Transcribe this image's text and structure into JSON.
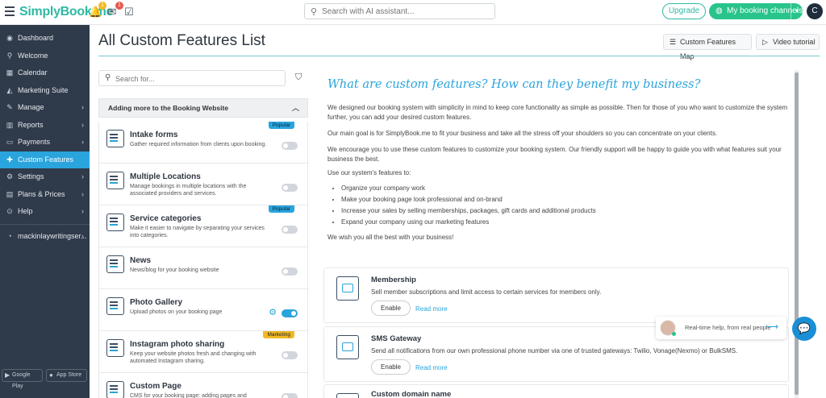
{
  "header": {
    "logo": "SimplyBook.me",
    "notifications_badge": "1",
    "messages_badge": "1",
    "search_placeholder": "Search with AI assistant...",
    "upgrade_label": "Upgrade",
    "channels_label": "My booking channels",
    "avatar_letter": "C"
  },
  "sidebar": {
    "items": [
      {
        "label": "Dashboard",
        "icon": "dashboard-icon",
        "glyph": "◉",
        "chevron": false,
        "active": false
      },
      {
        "label": "Welcome",
        "icon": "pin-icon",
        "glyph": "⚲",
        "chevron": false,
        "active": false
      },
      {
        "label": "Calendar",
        "icon": "calendar-icon",
        "glyph": "▦",
        "chevron": false,
        "active": false
      },
      {
        "label": "Marketing Suite",
        "icon": "megaphone-icon",
        "glyph": "◭",
        "chevron": false,
        "active": false
      },
      {
        "label": "Manage",
        "icon": "pencil-icon",
        "glyph": "✎",
        "chevron": true,
        "active": false
      },
      {
        "label": "Reports",
        "icon": "chart-icon",
        "glyph": "▥",
        "chevron": true,
        "active": false
      },
      {
        "label": "Payments",
        "icon": "card-icon",
        "glyph": "▭",
        "chevron": true,
        "active": false
      },
      {
        "label": "Custom Features",
        "icon": "puzzle-icon",
        "glyph": "✚",
        "chevron": false,
        "active": true
      },
      {
        "label": "Settings",
        "icon": "gear-icon",
        "glyph": "⚙",
        "chevron": true,
        "active": false
      },
      {
        "label": "Plans & Prices",
        "icon": "tag-icon",
        "glyph": "▤",
        "chevron": true,
        "active": false
      },
      {
        "label": "Help",
        "icon": "help-icon",
        "glyph": "⊙",
        "chevron": true,
        "active": false
      }
    ],
    "account": "mackinlaywritingser...",
    "google_play": "Google Play",
    "app_store": "App Store"
  },
  "page": {
    "title": "All Custom Features List",
    "map_button": "Custom Features Map",
    "video_button": "Video tutorial"
  },
  "features": {
    "search_placeholder": "Search for...",
    "group_title": "Adding more to the Booking Website",
    "items": [
      {
        "title": "Intake forms",
        "desc": "Gather required information from clients upon booking.",
        "badge": "Popular",
        "badge_color": "#29a4dc",
        "enabled": false,
        "gear": false
      },
      {
        "title": "Multiple Locations",
        "desc": "Manage bookings in multiple locations with the associated providers and services.",
        "badge": "",
        "badge_color": "",
        "enabled": false,
        "gear": false
      },
      {
        "title": "Service categories",
        "desc": "Make it easier to navigate by separating your services into categories.",
        "badge": "Popular",
        "badge_color": "#29a4dc",
        "enabled": false,
        "gear": false
      },
      {
        "title": "News",
        "desc": "News/blog for your booking website",
        "badge": "",
        "badge_color": "",
        "enabled": false,
        "gear": false
      },
      {
        "title": "Photo Gallery",
        "desc": "Upload photos on your booking page",
        "badge": "",
        "badge_color": "",
        "enabled": true,
        "gear": true
      },
      {
        "title": "Instagram photo sharing",
        "desc": "Keep your website photos fresh and changing with automated Instagram sharing.",
        "badge": "Marketing",
        "badge_color": "#f2b824",
        "enabled": false,
        "gear": false
      },
      {
        "title": "Custom Page",
        "desc": "CMS for your booking page: adding pages and organize menu",
        "badge": "",
        "badge_color": "",
        "enabled": false,
        "gear": false
      }
    ]
  },
  "info": {
    "title": "What are custom features? How can they benefit my business?",
    "p1": "We designed our booking system with simplicity in mind to keep core functionality as simple as possible. Then for those of you who want to customize the system further, you can add your desired custom features.",
    "p2": "Our main goal is for SimplyBook.me to fit your business and take all the stress off your shoulders so you can concentrate on your clients.",
    "p3": "We encourage you to use these custom features to customize your booking system. Our friendly support will be happy to guide you with what features suit your business the best.",
    "p4": "Use our system's features to:",
    "bullets": [
      "Organize your company work",
      "Make your booking page look professional and on-brand",
      "Increase your sales by selling memberships, packages, gift cards and additional products",
      "Expand your company using our marketing features"
    ],
    "p5": "We wish you all the best with your business!"
  },
  "cards": [
    {
      "title": "Membership",
      "desc": "Sell member subscriptions and limit access to certain services for members only.",
      "enable": "Enable",
      "more": "Read more"
    },
    {
      "title": "SMS Gateway",
      "desc": "Send all notifications from our own professional phone number via one of trusted gateways: Twilio, Vonage(Nexmo) or BulkSMS.",
      "enable": "Enable",
      "more": "Read more"
    },
    {
      "title": "Custom domain name",
      "desc": "",
      "enable": "",
      "more": ""
    }
  ],
  "chat": {
    "text": "Real-time help, from real people"
  },
  "colors": {
    "accent": "#29a4dc",
    "brand": "#2fb9a4",
    "sidebar": "#2f3a4a",
    "green": "#28c48b"
  }
}
